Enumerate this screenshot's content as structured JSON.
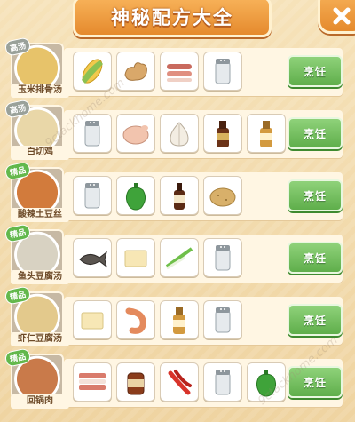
{
  "title": "神秘配方大全",
  "cook_label": "烹饪",
  "watermark": "9ctackhome.com",
  "recipes": [
    {
      "name": "玉米排骨汤",
      "tag": "高汤",
      "tag_color": "gray",
      "ingredients": [
        "corn",
        "ginger",
        "pork-ribs",
        "salt"
      ]
    },
    {
      "name": "白切鸡",
      "tag": "高汤",
      "tag_color": "gray",
      "ingredients": [
        "salt",
        "raw-chicken",
        "garlic",
        "soy-sauce",
        "sesame-sauce"
      ]
    },
    {
      "name": "酸辣土豆丝",
      "tag": "精品",
      "tag_color": "green",
      "ingredients": [
        "salt",
        "green-pepper",
        "vinegar",
        "potato"
      ]
    },
    {
      "name": "鱼头豆腐汤",
      "tag": "精品",
      "tag_color": "green",
      "ingredients": [
        "fish",
        "tofu",
        "scallion",
        "salt"
      ]
    },
    {
      "name": "虾仁豆腐汤",
      "tag": "精品",
      "tag_color": "green",
      "ingredients": [
        "tofu",
        "shrimp",
        "sesame-sauce",
        "salt"
      ]
    },
    {
      "name": "回锅肉",
      "tag": "精品",
      "tag_color": "green",
      "ingredients": [
        "pork-belly",
        "bean-paste",
        "red-chili",
        "salt",
        "green-pepper"
      ]
    }
  ]
}
